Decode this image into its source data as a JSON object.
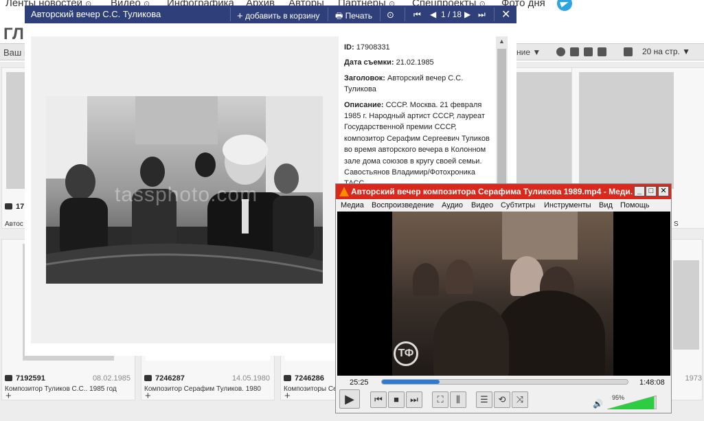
{
  "site": {
    "nav": [
      {
        "label": "Ленты новостей",
        "has_arrow": true
      },
      {
        "label": "Видео",
        "has_arrow": true
      },
      {
        "label": "Инфографика",
        "has_arrow": false
      },
      {
        "label": "Архив",
        "has_arrow": false
      },
      {
        "label": "Авторы",
        "has_arrow": false
      },
      {
        "label": "Партнеры",
        "has_arrow": true
      },
      {
        "label": "Спецпроекты",
        "has_arrow": true
      },
      {
        "label": "Фото дня",
        "has_arrow": false
      }
    ],
    "heading": "ГЛ",
    "toolbar": {
      "crumb": "Ваш п",
      "sort": "ние ▼",
      "per_page": "20 на стр. ▼"
    },
    "cards": [
      {
        "id": "17",
        "date": "",
        "caption": "Автос"
      },
      {
        "id": "7192591",
        "date": "08.02.1985",
        "caption": "Композитор Туликов С.С.. 1985 год"
      },
      {
        "id": "7246287",
        "date": "14.05.1980",
        "caption": "Композитор Серафим Туликов. 1980"
      },
      {
        "id": "7246286",
        "date": "",
        "caption": "Композиторы Серафим"
      },
      {
        "id": "",
        "date": "",
        "caption": "S"
      },
      {
        "id": "",
        "date": "1973",
        "caption": ""
      }
    ]
  },
  "modal": {
    "title": "Авторский вечер С.С. Туликова",
    "add_to_cart": "добавить в корзину",
    "print": "Печать",
    "pager": "1 / 18",
    "meta": {
      "id_label": "ID:",
      "id_value": "17908331",
      "date_label": "Дата съемки:",
      "date_value": "21.02.1985",
      "heading_label": "Заголовок:",
      "heading_value": "Авторский вечер С.С. Туликова",
      "desc_label": "Описание:",
      "desc_value": "СССР. Москва. 21 февраля 1985 г. Народный артист СССР, лауреат Государственной премии СССР, композитор Серафим Сергеевич Туликов во время авторского вечера в Колонном зале дома союзов в кругу своей семьи. Савостьянов Владимир/Фотохроника ТАСС"
    },
    "watermark": "tassphoto.com"
  },
  "player": {
    "title": "Авторский вечер композитора Серафима Туликова 1989.mp4 - Меди...",
    "menu": [
      "Медиа",
      "Воспроизведение",
      "Аудио",
      "Видео",
      "Субтитры",
      "Инструменты",
      "Вид",
      "Помощь"
    ],
    "time_elapsed": "25:25",
    "time_total": "1:48:08",
    "progress": 0.235,
    "volume_label": "95%",
    "volume": 0.95,
    "tv_logo": "ТФ"
  },
  "colors": {
    "modal_header": "#2f3f7a",
    "player_title": "#d9291c",
    "seek_fill": "#2a7bd4",
    "volume_fill": "#2ecc40"
  }
}
